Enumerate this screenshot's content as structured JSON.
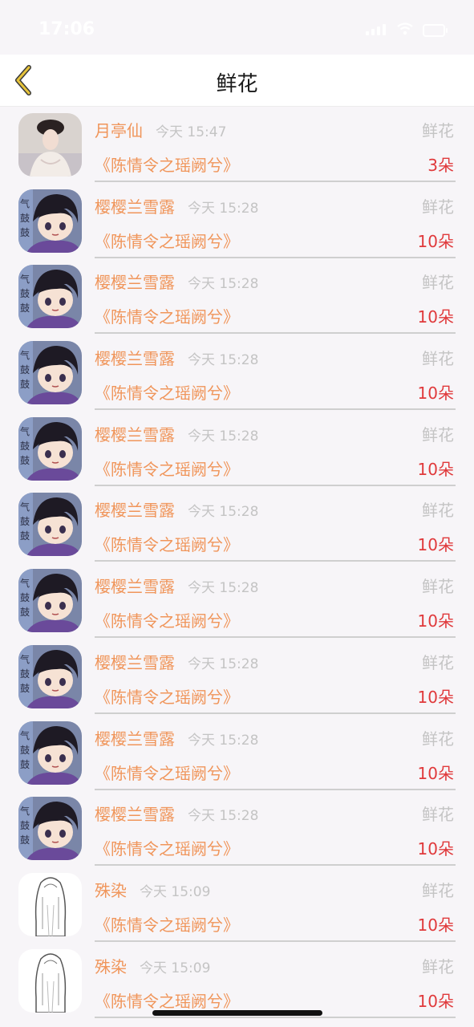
{
  "status_bar": {
    "time": "17:06"
  },
  "nav": {
    "title": "鲜花"
  },
  "items": [
    {
      "name": "月亭仙",
      "time": "今天 15:47",
      "type": "鲜花",
      "book": "《陈情令之瑶阙兮》",
      "count": "3朵",
      "avatar": "portrait-photo"
    },
    {
      "name": "樱樱兰雪露",
      "time": "今天 15:28",
      "type": "鲜花",
      "book": "《陈情令之瑶阙兮》",
      "count": "10朵",
      "avatar": "anime-character"
    },
    {
      "name": "樱樱兰雪露",
      "time": "今天 15:28",
      "type": "鲜花",
      "book": "《陈情令之瑶阙兮》",
      "count": "10朵",
      "avatar": "anime-character"
    },
    {
      "name": "樱樱兰雪露",
      "time": "今天 15:28",
      "type": "鲜花",
      "book": "《陈情令之瑶阙兮》",
      "count": "10朵",
      "avatar": "anime-character"
    },
    {
      "name": "樱樱兰雪露",
      "time": "今天 15:28",
      "type": "鲜花",
      "book": "《陈情令之瑶阙兮》",
      "count": "10朵",
      "avatar": "anime-character"
    },
    {
      "name": "樱樱兰雪露",
      "time": "今天 15:28",
      "type": "鲜花",
      "book": "《陈情令之瑶阙兮》",
      "count": "10朵",
      "avatar": "anime-character"
    },
    {
      "name": "樱樱兰雪露",
      "time": "今天 15:28",
      "type": "鲜花",
      "book": "《陈情令之瑶阙兮》",
      "count": "10朵",
      "avatar": "anime-character"
    },
    {
      "name": "樱樱兰雪露",
      "time": "今天 15:28",
      "type": "鲜花",
      "book": "《陈情令之瑶阙兮》",
      "count": "10朵",
      "avatar": "anime-character"
    },
    {
      "name": "樱樱兰雪露",
      "time": "今天 15:28",
      "type": "鲜花",
      "book": "《陈情令之瑶阙兮》",
      "count": "10朵",
      "avatar": "anime-character"
    },
    {
      "name": "樱樱兰雪露",
      "time": "今天 15:28",
      "type": "鲜花",
      "book": "《陈情令之瑶阙兮》",
      "count": "10朵",
      "avatar": "anime-character"
    },
    {
      "name": "殊染",
      "time": "今天 15:09",
      "type": "鲜花",
      "book": "《陈情令之瑶阙兮》",
      "count": "10朵",
      "avatar": "sketch-figure"
    },
    {
      "name": "殊染",
      "time": "今天 15:09",
      "type": "鲜花",
      "book": "《陈情令之瑶阙兮》",
      "count": "10朵",
      "avatar": "sketch-figure"
    }
  ],
  "colors": {
    "accent": "#f0955a",
    "count": "#e0393b",
    "muted": "#c4c4c4",
    "back_icon": "#e6c33a"
  }
}
